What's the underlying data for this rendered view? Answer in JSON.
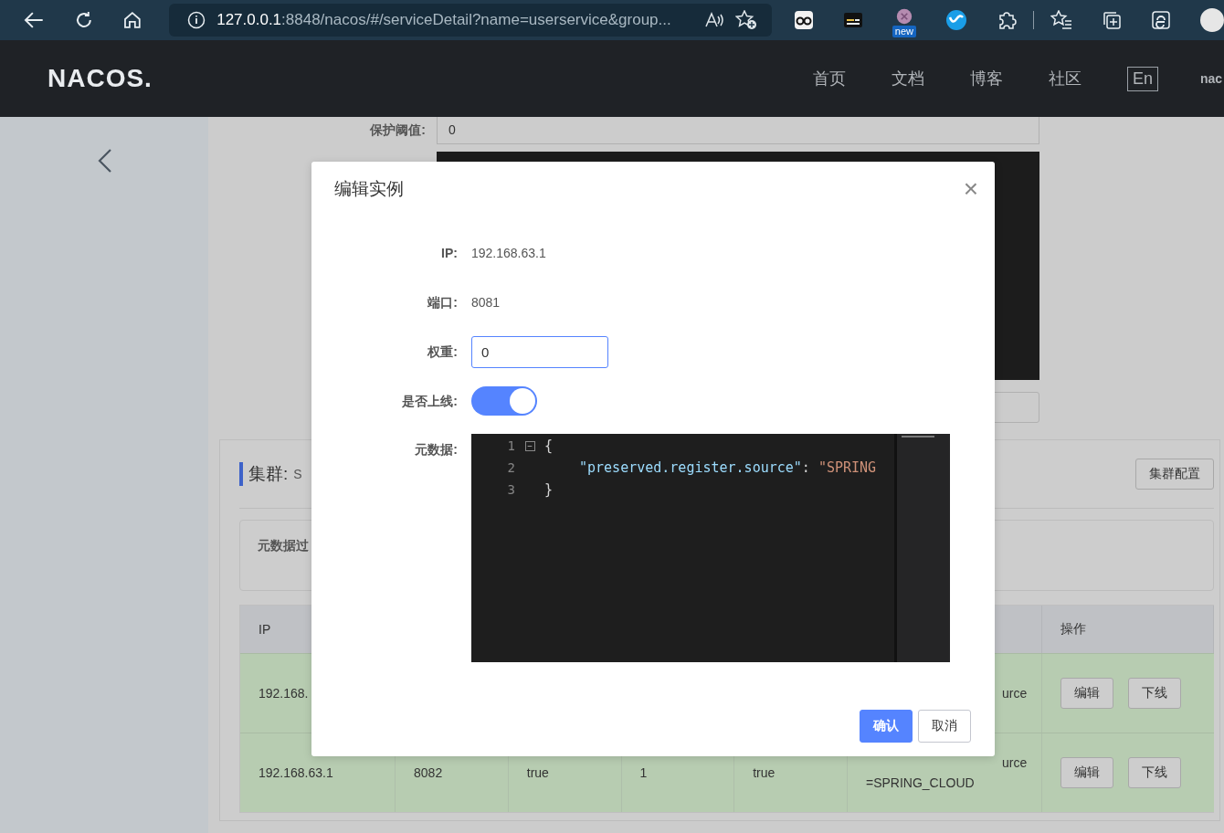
{
  "browser": {
    "url_host": "127.0.0.1",
    "url_rest": ":8848/nacos/#/serviceDetail?name=userservice&group...",
    "badge": "new"
  },
  "header": {
    "logo": "NACOS.",
    "nav": [
      {
        "label": "首页"
      },
      {
        "label": "文档"
      },
      {
        "label": "博客"
      },
      {
        "label": "社区"
      }
    ],
    "language": "En",
    "user": "nac"
  },
  "page": {
    "threshold": {
      "label": "保护阈值:",
      "value": "0"
    },
    "cluster": {
      "title": "集群:",
      "name": "S",
      "config_button": "集群配置",
      "filter_label": "元数据过",
      "table": {
        "columns": [
          "IP",
          "操作"
        ],
        "rows": [
          {
            "ip": "192.168.",
            "metadata": [
              "urce"
            ],
            "actions": [
              "编辑",
              "下线"
            ]
          },
          {
            "ip": "192.168.63.1",
            "port": "8082",
            "ephemeral": "true",
            "weight": "1",
            "healthy": "true",
            "metadata": [
              "urce",
              "=SPRING_CLOUD"
            ],
            "actions": [
              "编辑",
              "下线"
            ]
          }
        ]
      }
    }
  },
  "dialog": {
    "title": "编辑实例",
    "close": "×",
    "fields": [
      {
        "kind": "text",
        "label": "IP:",
        "value": "192.168.63.1"
      },
      {
        "kind": "text",
        "label": "端口:",
        "value": "8081"
      },
      {
        "kind": "input",
        "label": "权重:",
        "value": "0"
      },
      {
        "kind": "switch",
        "label": "是否上线:",
        "on": true
      },
      {
        "kind": "code",
        "label": "元数据:",
        "lines": [
          {
            "number": "1",
            "fold": "−",
            "tokens": [
              {
                "kind": "punct",
                "text": "{"
              }
            ]
          },
          {
            "number": "2",
            "tokens": [
              {
                "kind": "key",
                "text": "\"preserved.register.source\""
              },
              {
                "kind": "punct",
                "text": ": "
              },
              {
                "kind": "string",
                "text": "\"SPRING"
              }
            ]
          },
          {
            "number": "3",
            "tokens": [
              {
                "kind": "punct",
                "text": "}"
              }
            ]
          }
        ]
      }
    ],
    "buttons": [
      {
        "kind": "primary",
        "label": "确认"
      },
      {
        "kind": "secondary",
        "label": "取消"
      }
    ]
  }
}
